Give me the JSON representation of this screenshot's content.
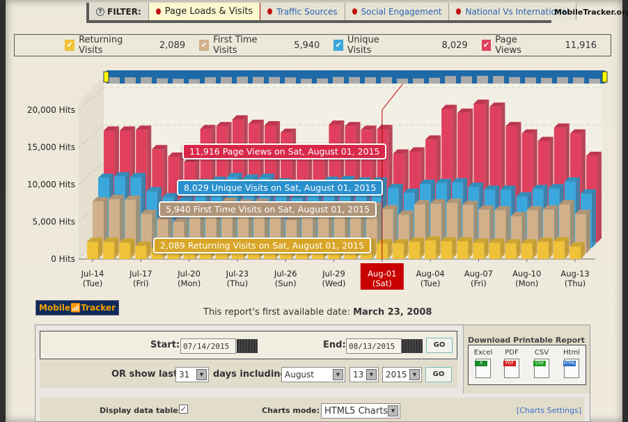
{
  "filter": {
    "label": "FILTER:",
    "tabs": [
      {
        "label": "Page Loads & Visits",
        "active": true
      },
      {
        "label": "Traffic Sources"
      },
      {
        "label": "Social Engagement"
      },
      {
        "label": "National Vs International"
      }
    ]
  },
  "brand": "MobileTracker.org",
  "legend": [
    {
      "label": "Returning Visits",
      "value": "2,089",
      "color": "#f0c23a"
    },
    {
      "label": "First Time Visits",
      "value": "5,940",
      "color": "#d2b08a"
    },
    {
      "label": "Unique Visits",
      "value": "8,029",
      "color": "#3aa8dc"
    },
    {
      "label": "Page Views",
      "value": "11,916",
      "color": "#e0405e"
    }
  ],
  "chart_data": {
    "type": "bar",
    "ylabel": "",
    "ylim": [
      0,
      20000
    ],
    "y_ticks": [
      "0 Hits",
      "5,000 Hits",
      "10,000 Hits",
      "15,000 Hits",
      "20,000 Hits"
    ],
    "x_tick_labels": [
      {
        "d": "Jul-14",
        "w": "(Tue)"
      },
      {
        "d": "Jul-17",
        "w": "(Fri)"
      },
      {
        "d": "Jul-20",
        "w": "(Mon)"
      },
      {
        "d": "Jul-23",
        "w": "(Thu)"
      },
      {
        "d": "Jul-26",
        "w": "(Sun)"
      },
      {
        "d": "Jul-29",
        "w": "(Wed)"
      },
      {
        "d": "Aug-01",
        "w": "(Sat)",
        "selected": true
      },
      {
        "d": "Aug-04",
        "w": "(Tue)"
      },
      {
        "d": "Aug-07",
        "w": "(Fri)"
      },
      {
        "d": "Aug-10",
        "w": "(Mon)"
      },
      {
        "d": "Aug-13",
        "w": "(Thu)"
      }
    ],
    "categories": [
      "Jul-14",
      "Jul-15",
      "Jul-16",
      "Jul-17",
      "Jul-18",
      "Jul-19",
      "Jul-20",
      "Jul-21",
      "Jul-22",
      "Jul-23",
      "Jul-24",
      "Jul-25",
      "Jul-26",
      "Jul-27",
      "Jul-28",
      "Jul-29",
      "Jul-30",
      "Jul-31",
      "Aug-01",
      "Aug-02",
      "Aug-03",
      "Aug-04",
      "Aug-05",
      "Aug-06",
      "Aug-07",
      "Aug-08",
      "Aug-09",
      "Aug-10",
      "Aug-11",
      "Aug-12",
      "Aug-13"
    ],
    "series": [
      {
        "name": "Returning Visits",
        "color": "#f0c23a",
        "values": [
          2300,
          2300,
          2200,
          1800,
          1500,
          1400,
          2100,
          2200,
          2300,
          2300,
          2200,
          2100,
          1500,
          1600,
          2200,
          2300,
          2200,
          2200,
          2089,
          2100,
          2300,
          2500,
          2400,
          2400,
          2200,
          2200,
          2100,
          2100,
          2300,
          2400,
          1700
        ]
      },
      {
        "name": "First Time Visits",
        "color": "#d2b08a",
        "values": [
          7000,
          7300,
          7200,
          5300,
          4600,
          4200,
          6200,
          6400,
          6900,
          6700,
          6800,
          6300,
          4500,
          4800,
          6400,
          6500,
          6300,
          6300,
          5940,
          5200,
          6600,
          6700,
          6800,
          6500,
          5900,
          5800,
          5000,
          5800,
          5900,
          6600,
          5300
        ]
      },
      {
        "name": "Unique Visits",
        "color": "#3aa8dc",
        "values": [
          9400,
          9600,
          9500,
          7600,
          6800,
          6400,
          8700,
          9000,
          9500,
          9300,
          9400,
          8800,
          6700,
          7200,
          9000,
          9100,
          8900,
          8900,
          8029,
          7400,
          8600,
          8700,
          8800,
          8200,
          7800,
          7800,
          6900,
          7900,
          8000,
          8900,
          7300
        ]
      },
      {
        "name": "Page Views",
        "color": "#e0405e",
        "values": [
          15000,
          15000,
          15100,
          12500,
          11500,
          10800,
          15200,
          15600,
          16500,
          15900,
          15700,
          14700,
          11400,
          12300,
          15800,
          15600,
          15100,
          15200,
          11916,
          12200,
          13800,
          17900,
          17400,
          18600,
          18200,
          15600,
          14600,
          13600,
          15400,
          14600,
          11600
        ]
      }
    ],
    "selected": "Aug-01",
    "tooltips": [
      "11,916 Page Views on Sat, August 01, 2015",
      "8,029 Unique Visits on Sat, August 01, 2015",
      "5,940 First Time Visits on Sat, August 01, 2015",
      "2,089 Returning Visits on Sat, August 01, 2015"
    ],
    "grid": true
  },
  "logo": {
    "left": "Mobile",
    "right": "Tracker"
  },
  "first_date": {
    "label": "This report's first available date:",
    "value": "March 23, 2008"
  },
  "form": {
    "start_label": "Start:",
    "start_value": "07/14/2015",
    "end_label": "End:",
    "end_value": "08/13/2015",
    "go": "GO",
    "or_label": "OR show last",
    "days": "31",
    "days_label": "days including",
    "month": "August",
    "day": "13",
    "year": "2015",
    "download_title": "Download Printable Report",
    "downloads": [
      {
        "label": "Excel",
        "badge": "X",
        "color": "#1a8a2a"
      },
      {
        "label": "PDF",
        "badge": "PDF",
        "color": "#d02020"
      },
      {
        "label": "CSV",
        "badge": "CSV",
        "color": "#20a020"
      },
      {
        "label": "Html",
        "badge": "HTML",
        "color": "#2a70c8"
      }
    ],
    "display_table_label": "Display data table:",
    "display_table_checked": "✓",
    "charts_mode_label": "Charts mode:",
    "charts_mode": "HTML5 Charts",
    "charts_settings": "[Charts Settings]"
  }
}
